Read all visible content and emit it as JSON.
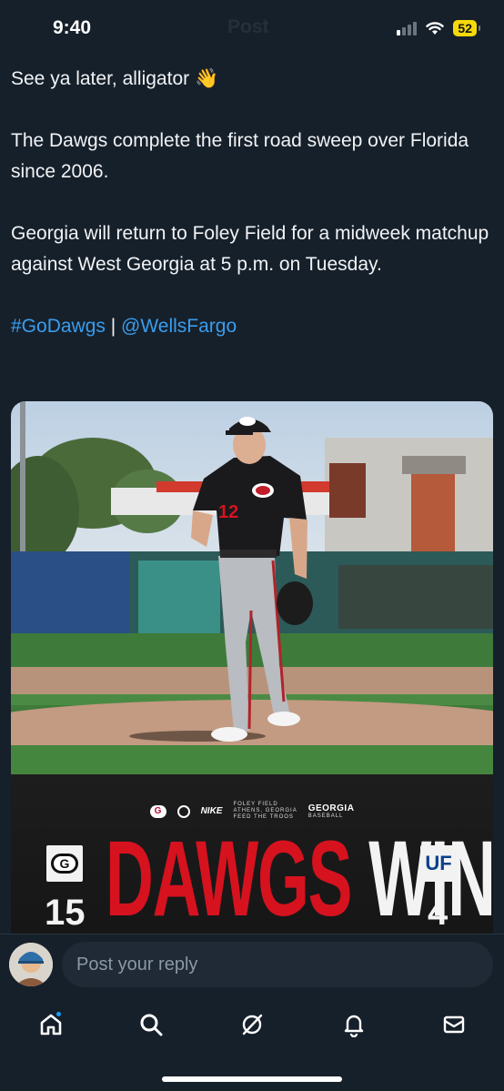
{
  "status_bar": {
    "time": "9:40",
    "battery": "52"
  },
  "header": {
    "title": "Post"
  },
  "post": {
    "line1": "See ya later, alligator 👋",
    "line2": "The Dawgs complete the first road sweep over Florida since 2006.",
    "line3": "Georgia will return to Foley Field for a midweek matchup against West Georgia at 5 p.m. on Tuesday.",
    "hashtag": "#GoDawgs",
    "separator": " | ",
    "mention": "@WellsFargo"
  },
  "media": {
    "player_number": "12",
    "cap_letter": "G",
    "chest_letter": "G",
    "sponsor_foley": "FOLEY FIELD",
    "sponsor_sub": "ATHENS, GEORGIA",
    "sponsor_tag": "FEED THE TROOS",
    "sponsor_georgia": "GEORGIA",
    "sponsor_baseball": "BASEBALL",
    "nike": "NIKE",
    "headline_red": "DAWGS",
    "headline_white": "WIN",
    "home_logo": "G",
    "home_score": "15",
    "away_score": "4",
    "away_logo": "UF"
  },
  "reply": {
    "placeholder": "Post your reply"
  },
  "tab_bar": {
    "items": [
      "home-icon",
      "search-icon",
      "grok-icon",
      "bell-icon",
      "mail-icon"
    ]
  },
  "colors": {
    "background": "#16202b",
    "link": "#3a9ded",
    "battery": "#f5d90a",
    "georgia_red": "#d6121f"
  }
}
